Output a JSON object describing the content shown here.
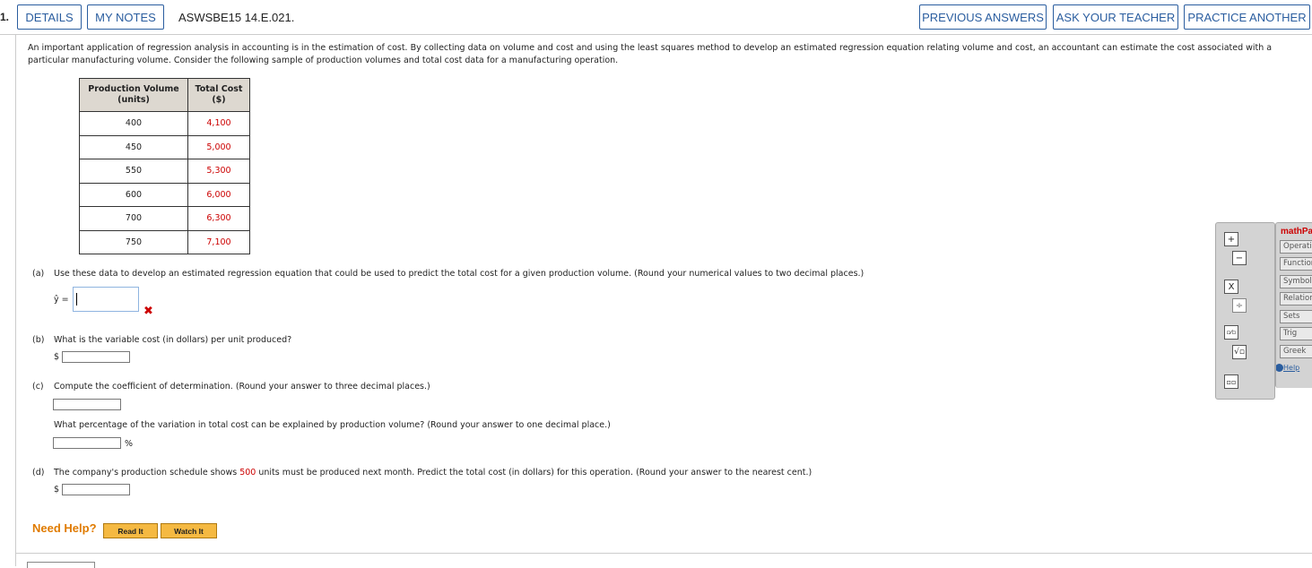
{
  "header": {
    "question_number": "1.",
    "details": "DETAILS",
    "my_notes": "MY NOTES",
    "code": "ASWSBE15 14.E.021.",
    "previous_answers": "PREVIOUS ANSWERS",
    "ask_teacher": "ASK YOUR TEACHER",
    "practice_another": "PRACTICE ANOTHER"
  },
  "intro": "An important application of regression analysis in accounting is in the estimation of cost. By collecting data on volume and cost and using the least squares method to develop an estimated regression equation relating volume and cost, an accountant can estimate the cost associated with a particular manufacturing volume. Consider the following sample of production volumes and total cost data for a manufacturing operation.",
  "table": {
    "col1_line1": "Production Volume",
    "col1_line2": "(units)",
    "col2_line1": "Total Cost",
    "col2_line2": "($)",
    "rows": [
      {
        "volume": "400",
        "cost": "4,100"
      },
      {
        "volume": "450",
        "cost": "5,000"
      },
      {
        "volume": "550",
        "cost": "5,300"
      },
      {
        "volume": "600",
        "cost": "6,000"
      },
      {
        "volume": "700",
        "cost": "6,300"
      },
      {
        "volume": "750",
        "cost": "7,100"
      }
    ]
  },
  "part_a": {
    "label": "(a)",
    "text": "Use these data to develop an estimated regression equation that could be used to predict the total cost for a given production volume. (Round your numerical values to two decimal places.)",
    "yhat": "ŷ =",
    "incorrect_mark": "✖"
  },
  "part_b": {
    "label": "(b)",
    "text": "What is the variable cost (in dollars) per unit produced?",
    "prefix": "$"
  },
  "part_c": {
    "label": "(c)",
    "text": "Compute the coefficient of determination. (Round your answer to three decimal places.)",
    "text2": "What percentage of the variation in total cost can be explained by production volume? (Round your answer to one decimal place.)",
    "suffix": "%"
  },
  "part_d": {
    "label": "(d)",
    "text_before": "The company's production schedule shows ",
    "highlight": "500",
    "text_after": " units must be produced next month. Predict the total cost (in dollars) for this operation. (Round your answer to the nearest cent.)",
    "prefix": "$"
  },
  "help": {
    "label": "Need Help?",
    "read_it": "Read It",
    "watch_it": "Watch It"
  },
  "palette": {
    "plus": "+",
    "minus": "−",
    "times": "X",
    "divide": "÷",
    "fraction": "▫⁄▫",
    "sqrt": "√▫",
    "power": "▫▫"
  },
  "mathpad": {
    "title": "mathPad",
    "tabs": [
      "Operations",
      "Functions",
      "Symbols",
      "Relations",
      "Sets",
      "Trig",
      "Greek"
    ],
    "help": "Help"
  }
}
